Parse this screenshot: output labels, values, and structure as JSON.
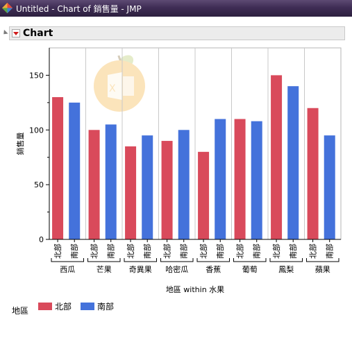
{
  "window": {
    "title": "Untitled - Chart of 銷售量 - JMP"
  },
  "outline": {
    "title": "Chart"
  },
  "chart_data": {
    "type": "bar",
    "categories": [
      "西瓜",
      "芒果",
      "奇異果",
      "哈密瓜",
      "香蕉",
      "葡萄",
      "鳳梨",
      "蘋果"
    ],
    "subcategories": [
      "北部",
      "南部"
    ],
    "series": [
      {
        "name": "北部",
        "color": "#d94a5b",
        "values": [
          130,
          100,
          85,
          90,
          80,
          110,
          150,
          120
        ]
      },
      {
        "name": "南部",
        "color": "#4472db",
        "values": [
          125,
          105,
          95,
          100,
          110,
          108,
          140,
          95
        ]
      }
    ],
    "ylabel": "銷售量",
    "xlabel": "地區 within 水果",
    "ylim": [
      0,
      175
    ],
    "yticks": [
      0,
      50,
      100,
      150
    ],
    "grid": "vertical separators",
    "legend": {
      "title": "地區",
      "position": "bottom-left"
    }
  },
  "colors": {
    "north": "#d94a5b",
    "south": "#4472db"
  }
}
